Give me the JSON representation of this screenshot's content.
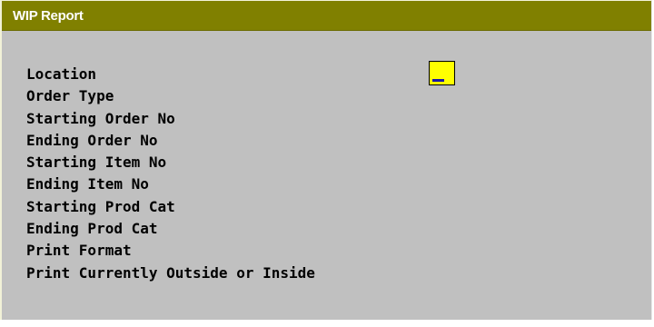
{
  "window": {
    "title": "WIP Report"
  },
  "form": {
    "labels": [
      "Location",
      "Order Type",
      "Starting Order No",
      "Ending Order No",
      "Starting Item No",
      "Ending Item No",
      "Starting Prod Cat",
      "Ending Prod Cat",
      "Print Format",
      "Print Currently Outside or Inside"
    ],
    "location_value": ""
  },
  "colors": {
    "titlebar": "#808000",
    "background": "#c0c0c0",
    "input_active": "#ffff00",
    "caret": "#1a1aa6"
  }
}
